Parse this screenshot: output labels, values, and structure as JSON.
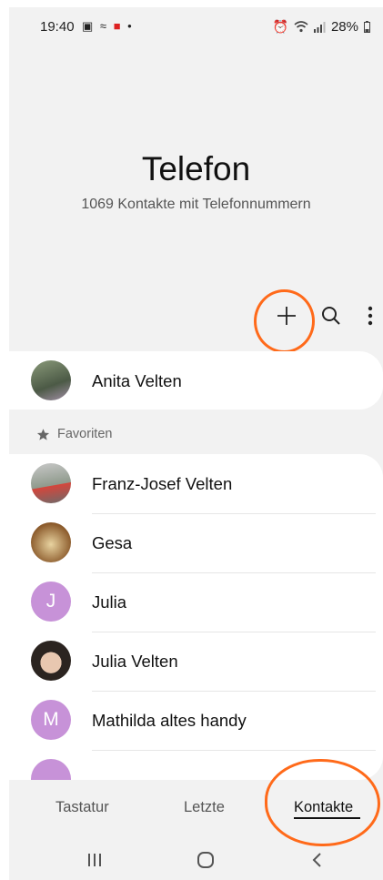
{
  "status_bar": {
    "time": "19:40",
    "left_icons": [
      "gallery-icon",
      "signal-wave-icon",
      "app-notification-icon",
      "dot-icon"
    ],
    "battery": "28%"
  },
  "header": {
    "title": "Telefon",
    "subtitle": "1069 Kontakte mit Telefonnummern"
  },
  "toolbar": {
    "add_icon": "plus-icon",
    "search_icon": "search-icon",
    "more_icon": "more-vertical-icon"
  },
  "profile": {
    "name": "Anita Velten"
  },
  "favorites": {
    "label": "Favoriten"
  },
  "contacts": [
    {
      "name": "Franz-Josef Velten",
      "initial": "",
      "avatar": "photo"
    },
    {
      "name": "Gesa",
      "initial": "",
      "avatar": "photo"
    },
    {
      "name": "Julia",
      "initial": "J",
      "avatar": "letter"
    },
    {
      "name": "Julia Velten",
      "initial": "",
      "avatar": "photo"
    },
    {
      "name": "Mathilda altes handy",
      "initial": "M",
      "avatar": "letter"
    }
  ],
  "tabs": [
    {
      "label": "Tastatur",
      "active": false
    },
    {
      "label": "Letzte",
      "active": false
    },
    {
      "label": "Kontakte",
      "active": true
    }
  ],
  "colors": {
    "accent_annotation": "#ff6a1a",
    "letter_avatar": "#c792d8"
  }
}
